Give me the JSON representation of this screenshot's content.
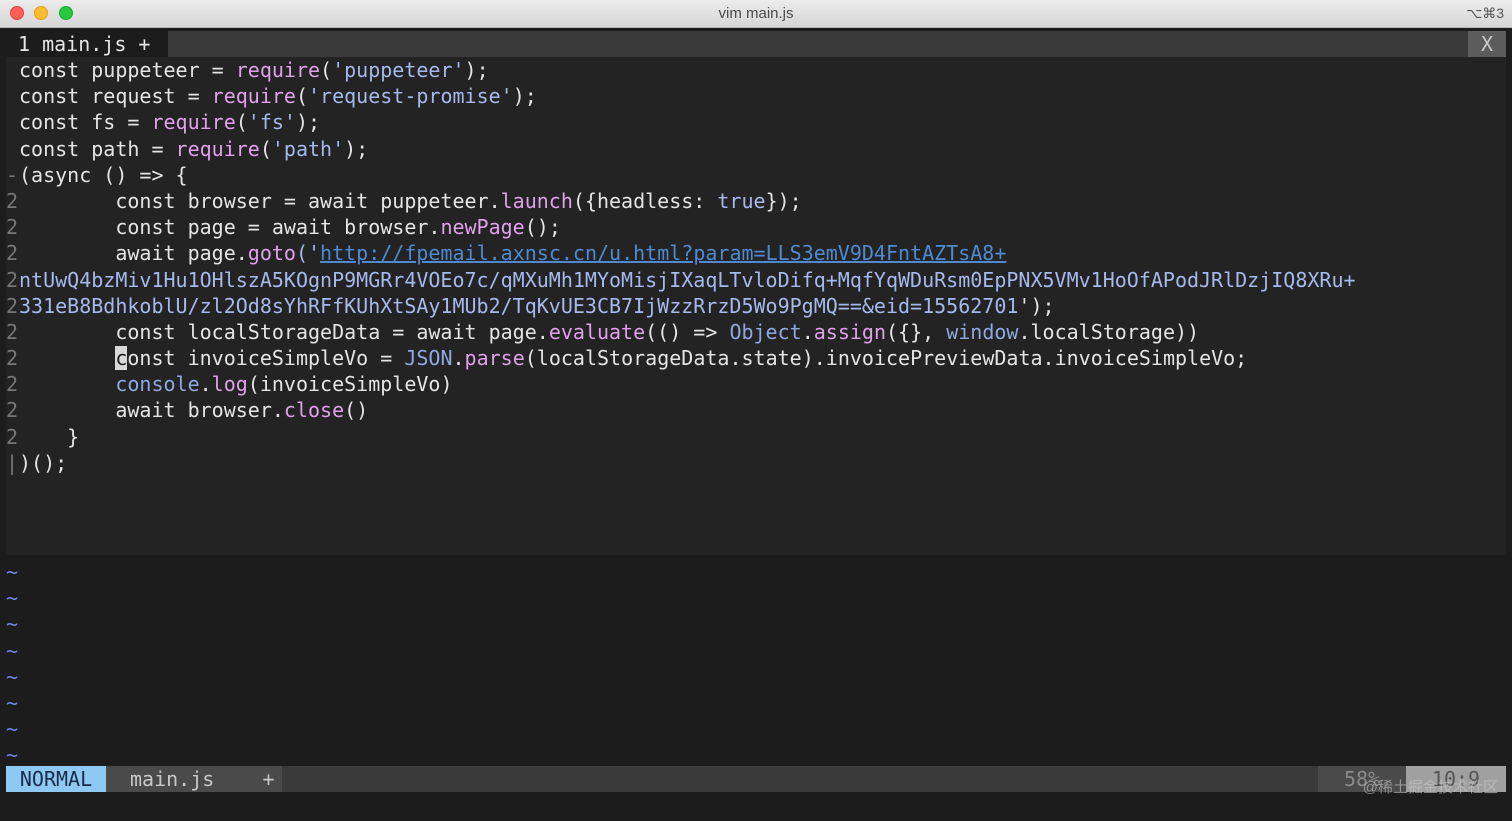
{
  "window": {
    "title": "vim main.js",
    "shortcut": "⌥⌘3"
  },
  "tabline": {
    "active_tab": "1 main.js +",
    "close": "X"
  },
  "colors": {
    "url": "#4f8ad1",
    "function": "#e0a0ea",
    "string": "#a5b9ec",
    "mode_bg": "#8ec9f3",
    "tilde": "#6b86e0"
  },
  "code": {
    "l1": {
      "a": "const puppeteer = ",
      "b": "require",
      "c": "(",
      "d": "'puppeteer'",
      "e": ");"
    },
    "l2": {
      "a": "const request = ",
      "b": "require",
      "c": "(",
      "d": "'request-promise'",
      "e": ");"
    },
    "l3": {
      "a": "const fs = ",
      "b": "require",
      "c": "(",
      "d": "'fs'",
      "e": ");"
    },
    "l4": {
      "a": "const path = ",
      "b": "require",
      "c": "(",
      "d": "'path'",
      "e": ");"
    },
    "l5": {
      "fold": "-",
      "a": "(async () => {"
    },
    "l6": {
      "fold": "2",
      "a": "        const browser = await puppeteer.",
      "b": "launch",
      "c": "({headless: ",
      "d": "true",
      "e": "});"
    },
    "l7": {
      "fold": "2",
      "a": "        const page = await browser.",
      "b": "newPage",
      "c": "();"
    },
    "l8": {
      "fold": "2",
      "a": "        await page.",
      "b": "goto",
      "c": "('",
      "d": "http://fpemail.axnsc.cn/u.html?param=LLS3emV9D4FntAZTsA8+"
    },
    "l9": {
      "fold": "2",
      "d": "ntUwQ4bzMiv1Hu1OHlszA5KOgnP9MGRr4VOEo7c/qMXuMh1MYoMisjIXaqLTvloDifq+MqfYqWDuRsm0EpPNX5VMv1HoOfAPodJRlDzjIQ8XRu+"
    },
    "l10": {
      "fold": "2",
      "d": "331eB8BdhkoblU/zl2Od8sYhRFfKUhXtSAy1MUb2/TqKvUE3CB7IjWzzRrzD5Wo9PgMQ==&eid=15562701",
      "e": "');"
    },
    "l11": {
      "fold": "2",
      "a": "        const localStorageData = await page.",
      "b": "evaluate",
      "c": "(() => ",
      "d": "Object",
      "e": ".",
      "f": "assign",
      "g": "({}, ",
      "h": "window",
      "i": ".localStorage))"
    },
    "l12": {
      "fold": "2",
      "pre": "        ",
      "cur": "c",
      "a": "onst invoiceSimpleVo = ",
      "b": "JSON",
      "c": ".",
      "d": "parse",
      "e": "(localStorageData.state).invoicePreviewData.invoiceSimpleVo;"
    },
    "l13": {
      "fold": "2",
      "a": "        ",
      "b": "console",
      "c": ".",
      "d": "log",
      "e": "(invoiceSimpleVo)"
    },
    "l14": {
      "fold": "2",
      "a": "        await browser.",
      "b": "close",
      "c": "()"
    },
    "l15": {
      "fold": "2",
      "a": "    }"
    },
    "l16": {
      "fold": "|",
      "a": ")();"
    }
  },
  "tilde": "~",
  "statusline": {
    "mode": "NORMAL",
    "file": "main.js    +",
    "percent": "58%",
    "position": "10:9"
  },
  "watermark": "@稀土掘金技术社区"
}
